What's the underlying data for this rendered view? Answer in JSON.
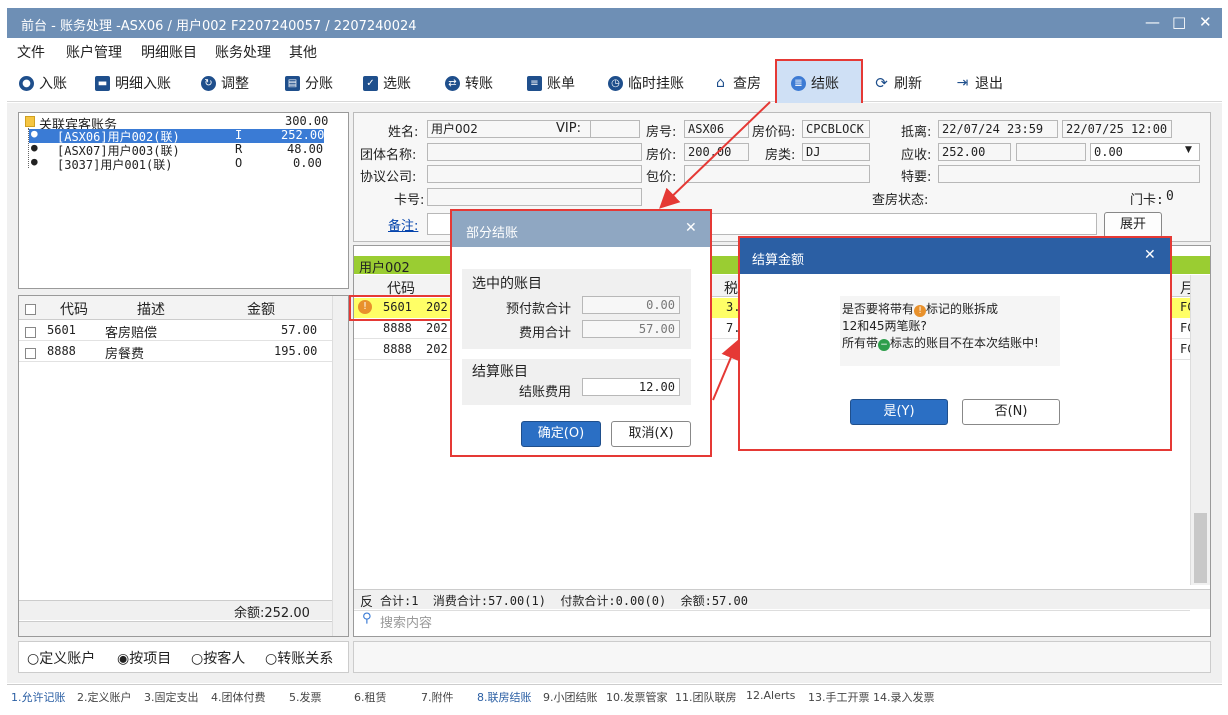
{
  "window": {
    "title": "前台 - 账务处理 -ASX06 / 用户002 F2207240057 / 2207240024"
  },
  "menu": [
    "文件",
    "账户管理",
    "明细账目",
    "账务处理",
    "其他"
  ],
  "toolbar": [
    {
      "label": "入账",
      "icon": "entry-icon"
    },
    {
      "label": "明细入账",
      "icon": "detail-entry-icon"
    },
    {
      "label": "调整",
      "icon": "adjust-icon"
    },
    {
      "label": "分账",
      "icon": "split-icon"
    },
    {
      "label": "选账",
      "icon": "select-icon"
    },
    {
      "label": "转账",
      "icon": "transfer-icon"
    },
    {
      "label": "账单",
      "icon": "bill-icon"
    },
    {
      "label": "临时挂账",
      "icon": "clock-icon"
    },
    {
      "label": "查房",
      "icon": "house-icon"
    },
    {
      "label": "结账",
      "icon": "database-icon"
    },
    {
      "label": "刷新",
      "icon": "refresh-icon"
    },
    {
      "label": "退出",
      "icon": "exit-icon"
    }
  ],
  "tree": {
    "root": {
      "label": "关联宾客账务",
      "amount": "300.00"
    },
    "items": [
      {
        "label": "[ASX06]用户002(联)",
        "status": "I",
        "amount": "252.00"
      },
      {
        "label": "[ASX07]用户003(联)",
        "status": "R",
        "amount": "48.00"
      },
      {
        "label": "[3037]用户001(联)",
        "status": "O",
        "amount": "0.00"
      }
    ]
  },
  "left_grid": {
    "headers": [
      "代码",
      "描述",
      "金额"
    ],
    "rows": [
      {
        "code": "5601",
        "desc": "客房赔偿",
        "amount": "57.00"
      },
      {
        "code": "8888",
        "desc": "房餐费",
        "amount": "195.00"
      }
    ],
    "balance": "余额:252.00"
  },
  "radio": {
    "options": [
      "定义账户",
      "按项目",
      "按客人",
      "转账关系"
    ],
    "selected": "按项目"
  },
  "guest": {
    "name_label": "姓名:",
    "name": "用户002",
    "vip_label": "VIP:",
    "vip": "",
    "room_label": "房号:",
    "room": "ASX06",
    "rate_code_label": "房价码:",
    "rate_code": "CPCBLOCK",
    "arrive_label": "抵离:",
    "arrive": "22/07/24 23:59",
    "depart": "22/07/25 12:00",
    "group_label": "团体名称:",
    "group": "",
    "price_label": "房价:",
    "price": "200.00",
    "room_type_label": "房类:",
    "room_type": "DJ",
    "receivable_label": "应收:",
    "receivable": "252.00",
    "receivable_sel": "0.00",
    "agreement_label": "协议公司:",
    "agreement": "",
    "package_label": "包价:",
    "package": "",
    "special_label": "特要:",
    "special": "",
    "card_label": "卡号:",
    "card": "",
    "check_label": "查房状态:",
    "door_label": "门卡:",
    "door": "0",
    "remark_label": "备注:",
    "expand_label": "展开"
  },
  "right_grid": {
    "guest": "用户002",
    "header_code": "代码",
    "header_tax": "税",
    "header_misc": "月",
    "rows": [
      {
        "code": "5601",
        "date": "202",
        "tax": "3.",
        "misc": "FC"
      },
      {
        "code": "8888",
        "date": "202",
        "tax": "7.",
        "misc": "FC"
      },
      {
        "code": "8888",
        "date": "202",
        "tax": "",
        "misc": "FC"
      }
    ],
    "footer_prefix": "反",
    "footer": "合计:1  消费合计:57.00(1)  付款合计:0.00(0)  余额:57.00",
    "search_placeholder": "搜索内容"
  },
  "dialog_partial": {
    "title": "部分结账",
    "group1": "选中的账目",
    "prepay_label": "预付款合计",
    "prepay": "0.00",
    "fee_label": "费用合计",
    "fee": "57.00",
    "group2": "结算账目",
    "settle_label": "结账费用",
    "settle": "12.00",
    "ok": "确定(O)",
    "cancel": "取消(X)"
  },
  "dialog_amount": {
    "title": "结算金额",
    "line1a": "是否要将带有",
    "line1b": "标记的账拆成",
    "line2": "12和45两笔账?",
    "line3a": "所有带",
    "line3b": "标志的账目不在本次结账中!",
    "yes": "是(Y)",
    "no": "否(N)"
  },
  "status_tabs": [
    "1.允许记账",
    "2.定义账户",
    "3.固定支出",
    "4.团体付费",
    "5.发票",
    "6.租赁",
    "7.附件",
    "8.联房结账",
    "9.小团结账",
    "10.发票管家",
    "11.团队联房",
    "12.Alerts",
    "13.手工开票",
    "14.录入发票"
  ],
  "colors": {
    "accent": "#1f4f8c",
    "title": "#6e8fb5",
    "dialog1": "#8fa7c2",
    "dialog2": "#2b5fa4",
    "highlight": "#e53935",
    "yellow": "#ffff66",
    "green": "#9acd32"
  }
}
